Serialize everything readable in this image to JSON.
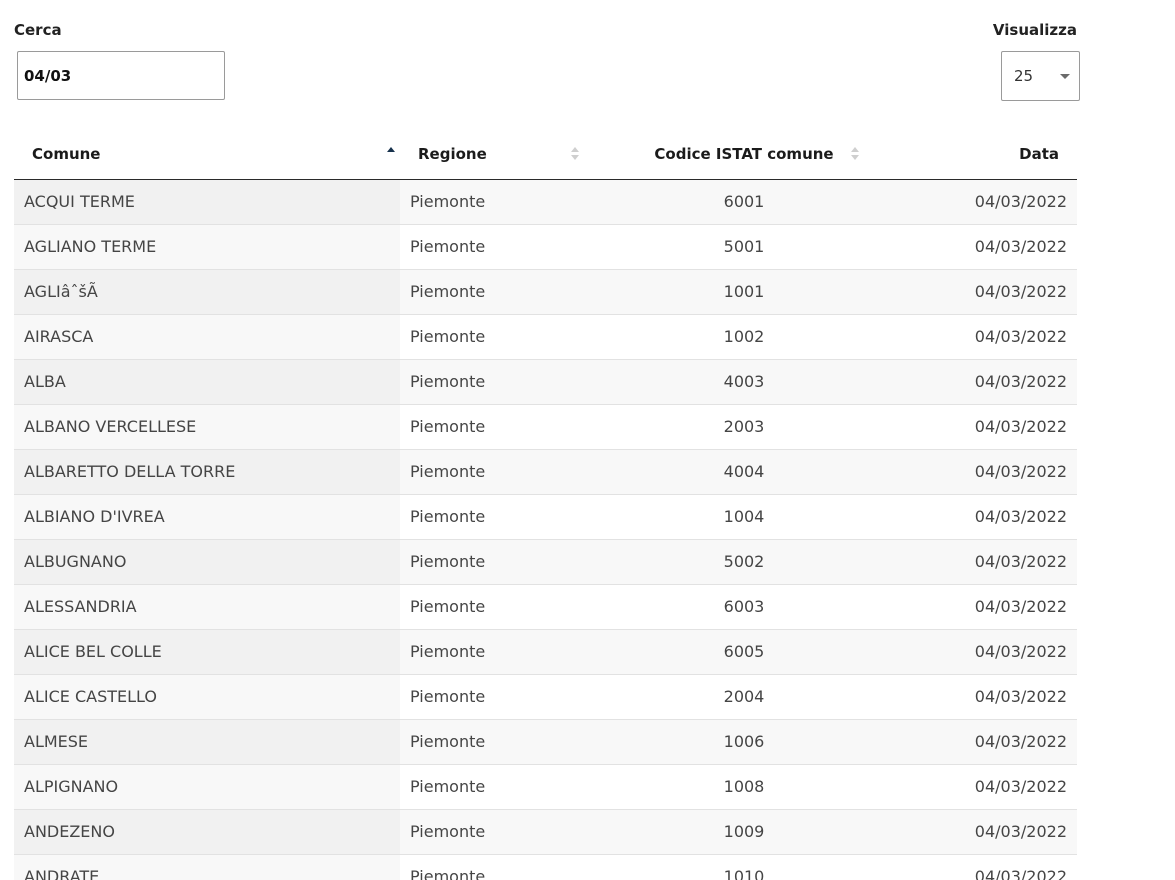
{
  "search": {
    "label": "Cerca",
    "value": "04/03"
  },
  "page_size": {
    "label": "Visualizza",
    "value": "25"
  },
  "table": {
    "sorted_column": "Comune",
    "sort_direction": "ascending",
    "columns": [
      "Comune",
      "Regione",
      "Codice ISTAT comune",
      "Data"
    ],
    "rows": [
      [
        "ACQUI TERME",
        "Piemonte",
        "6001",
        "04/03/2022"
      ],
      [
        "AGLIANO TERME",
        "Piemonte",
        "5001",
        "04/03/2022"
      ],
      [
        "AGLIâˆšÃ ",
        "Piemonte",
        "1001",
        "04/03/2022"
      ],
      [
        "AIRASCA",
        "Piemonte",
        "1002",
        "04/03/2022"
      ],
      [
        "ALBA",
        "Piemonte",
        "4003",
        "04/03/2022"
      ],
      [
        "ALBANO VERCELLESE",
        "Piemonte",
        "2003",
        "04/03/2022"
      ],
      [
        "ALBARETTO DELLA TORRE",
        "Piemonte",
        "4004",
        "04/03/2022"
      ],
      [
        "ALBIANO D'IVREA",
        "Piemonte",
        "1004",
        "04/03/2022"
      ],
      [
        "ALBUGNANO",
        "Piemonte",
        "5002",
        "04/03/2022"
      ],
      [
        "ALESSANDRIA",
        "Piemonte",
        "6003",
        "04/03/2022"
      ],
      [
        "ALICE BEL COLLE",
        "Piemonte",
        "6005",
        "04/03/2022"
      ],
      [
        "ALICE CASTELLO",
        "Piemonte",
        "2004",
        "04/03/2022"
      ],
      [
        "ALMESE",
        "Piemonte",
        "1006",
        "04/03/2022"
      ],
      [
        "ALPIGNANO",
        "Piemonte",
        "1008",
        "04/03/2022"
      ],
      [
        "ANDEZENO",
        "Piemonte",
        "1009",
        "04/03/2022"
      ],
      [
        "ANDRATE",
        "Piemonte",
        "1010",
        "04/03/2022"
      ]
    ]
  }
}
